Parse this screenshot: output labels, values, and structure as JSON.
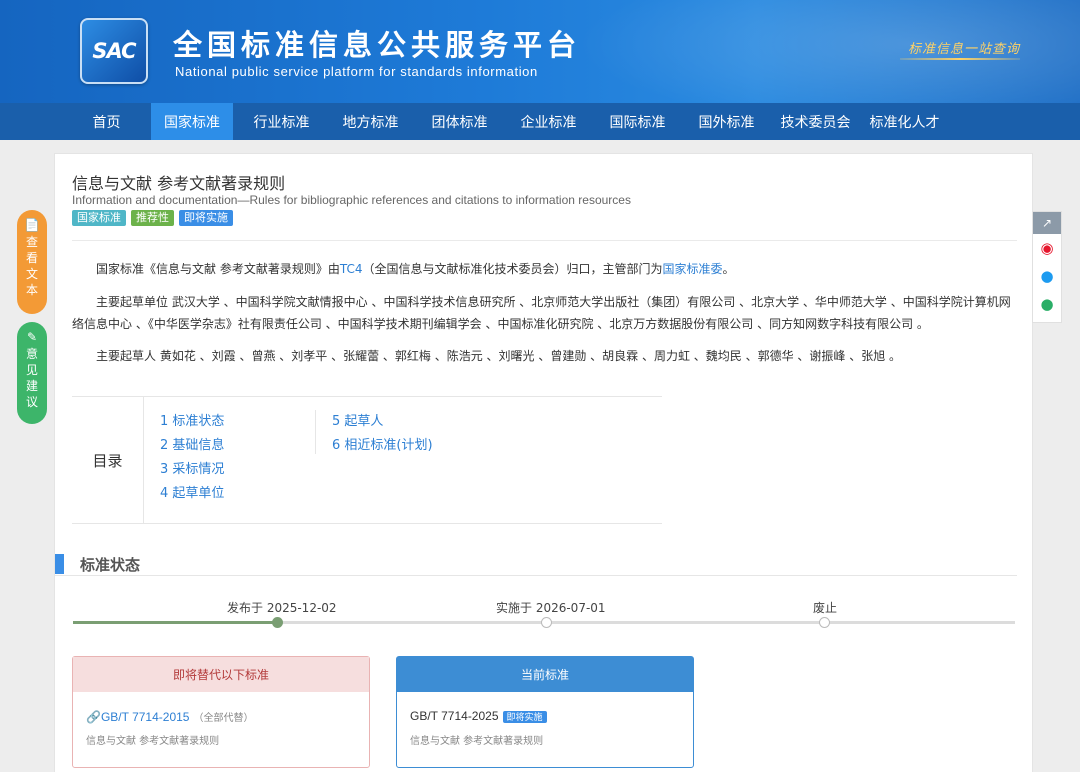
{
  "header": {
    "logo_text": "SAC",
    "title": "全国标准信息公共服务平台",
    "subtitle": "National public service platform  for standards information",
    "slogan": "标准信息一站查询"
  },
  "nav": {
    "items": [
      "首页",
      "国家标准",
      "行业标准",
      "地方标准",
      "团体标准",
      "企业标准",
      "国际标准",
      "国外标准",
      "技术委员会",
      "标准化人才"
    ],
    "active_index": 1
  },
  "standard": {
    "title": "信息与文献 参考文献著录规则",
    "title_en": "Information and documentation—Rules for bibliographic references and citations to information resources",
    "badges": [
      {
        "label": "国家标准",
        "color": "#4fb6c7"
      },
      {
        "label": "推荐性",
        "color": "#6cb24a"
      },
      {
        "label": "即将实施",
        "color": "#3a8ee6"
      }
    ]
  },
  "intro": {
    "p1_pre": "国家标准《信息与文献 参考文献著录规则》由",
    "p1_tc": "TC4",
    "p1_mid": "（全国信息与文献标准化技术委员会）归口，主管部门为",
    "p1_dept": "国家标准委",
    "p1_end": "。",
    "p2": "主要起草单位 武汉大学 、中国科学院文献情报中心 、中国科学技术信息研究所 、北京师范大学出版社（集团）有限公司 、北京大学 、华中师范大学 、中国科学院计算机网络信息中心 、《中华医学杂志》社有限责任公司 、中国科学技术期刊编辑学会 、中国标准化研究院 、北京万方数据股份有限公司 、同方知网数字科技有限公司 。",
    "p3": "主要起草人 黄如花 、刘霞 、曾燕 、刘孝平 、张耀蕾 、郭红梅 、陈浩元 、刘曙光 、曾建勋 、胡良霖 、周力虹 、魏均民 、郭德华 、谢振峰 、张旭 。"
  },
  "toc": {
    "label": "目录",
    "col1": [
      "1 标准状态",
      "2 基础信息",
      "3 采标情况",
      "4 起草单位"
    ],
    "col2": [
      "5 起草人",
      "6 相近标准(计划)"
    ]
  },
  "status_section": {
    "title": "标准状态",
    "timeline": [
      {
        "label": "发布于 2025-12-02",
        "done": true
      },
      {
        "label": "实施于 2026-07-01",
        "done": false
      },
      {
        "label": "废止",
        "done": false
      }
    ]
  },
  "replace_box": {
    "header": "即将替代以下标准",
    "code": "GB/T 7714-2015",
    "note": "（全部代替）",
    "desc": "信息与文献 参考文献著录规则",
    "border_color": "#e9b3b3",
    "header_bg": "#f6dede",
    "header_color": "#b33a3a"
  },
  "current_box": {
    "header": "当前标准",
    "code": "GB/T 7714-2025",
    "badge": "即将实施",
    "desc": "信息与文献 参考文献著录规则",
    "header_bg": "#3d8dd4"
  },
  "float_left": {
    "view_text": "查看文本",
    "feedback_text": "意见建议"
  }
}
